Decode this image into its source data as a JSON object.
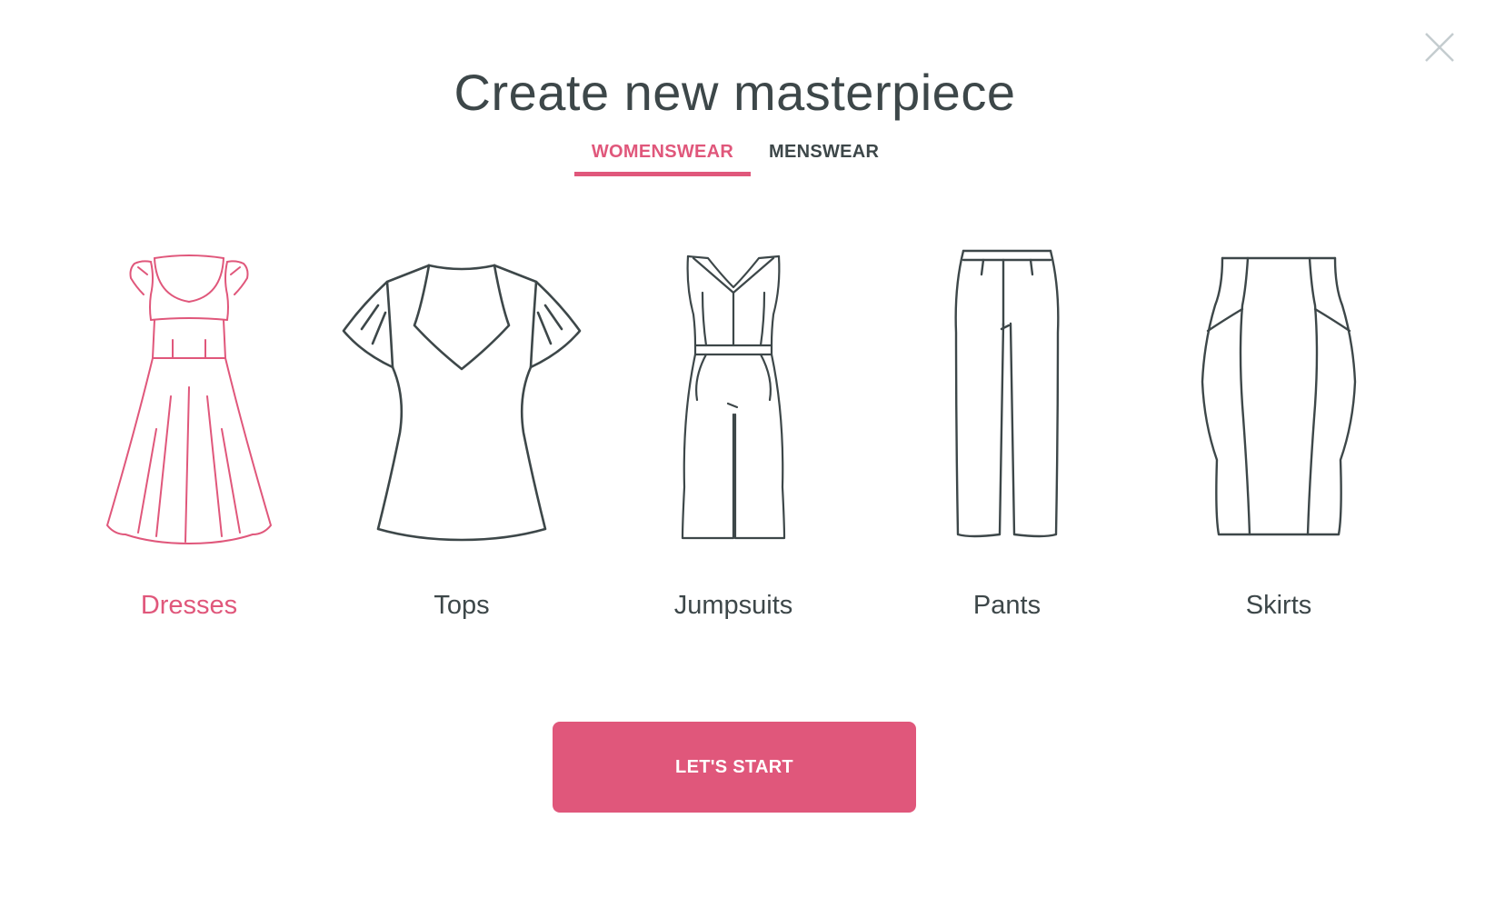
{
  "modal": {
    "title": "Create new masterpiece",
    "close_icon": "close-icon"
  },
  "tabs": [
    {
      "label": "WOMENSWEAR",
      "active": true
    },
    {
      "label": "MENSWEAR",
      "active": false
    }
  ],
  "categories": [
    {
      "label": "Dresses",
      "icon": "dress-icon",
      "selected": true
    },
    {
      "label": "Tops",
      "icon": "top-icon",
      "selected": false
    },
    {
      "label": "Jumpsuits",
      "icon": "jumpsuit-icon",
      "selected": false
    },
    {
      "label": "Pants",
      "icon": "pants-icon",
      "selected": false
    },
    {
      "label": "Skirts",
      "icon": "skirt-icon",
      "selected": false
    }
  ],
  "start_button": {
    "label": "LET'S START"
  },
  "colors": {
    "accent": "#e0577b",
    "text": "#3d4749",
    "close": "#c4cccf",
    "background": "#ffffff"
  }
}
